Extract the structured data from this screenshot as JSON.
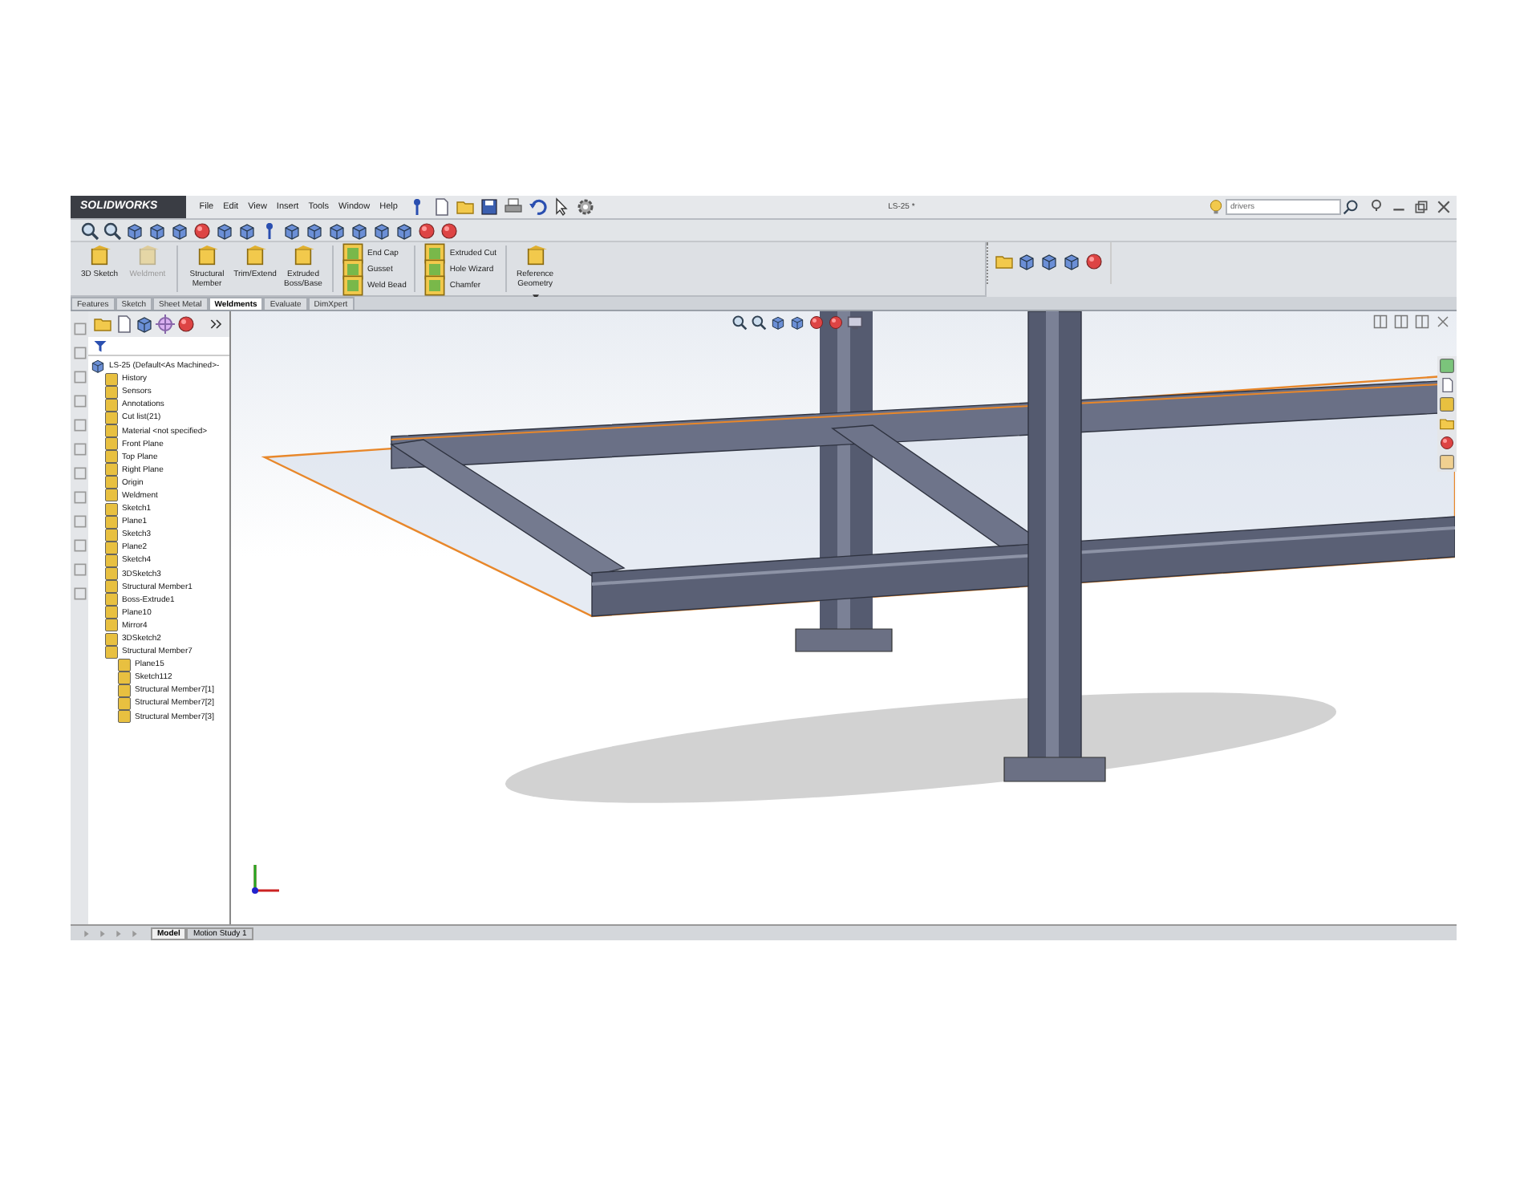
{
  "window": {
    "app": "SOLIDWORKS",
    "title": "LS-25 *"
  },
  "menu": [
    "File",
    "Edit",
    "View",
    "Insert",
    "Tools",
    "Window",
    "Help"
  ],
  "search": {
    "value": "drivers"
  },
  "command_groups": [
    {
      "kind": "large",
      "items": [
        {
          "label": "3D Sketch",
          "disabled": false
        },
        {
          "label": "Weldment",
          "disabled": true
        }
      ]
    },
    {
      "kind": "large",
      "items": [
        {
          "label": "Structural Member",
          "disabled": false
        },
        {
          "label": "Trim/Extend",
          "disabled": false
        },
        {
          "label": "Extruded Boss/Base",
          "disabled": false
        }
      ]
    },
    {
      "kind": "stack",
      "items": [
        {
          "label": "End Cap",
          "disabled": false
        },
        {
          "label": "Gusset",
          "disabled": false
        },
        {
          "label": "Weld Bead",
          "disabled": false
        }
      ]
    },
    {
      "kind": "stack",
      "items": [
        {
          "label": "Extruded Cut",
          "disabled": false
        },
        {
          "label": "Hole Wizard",
          "disabled": false
        },
        {
          "label": "Chamfer",
          "disabled": false
        }
      ]
    },
    {
      "kind": "large",
      "items": [
        {
          "label": "Reference Geometry",
          "disabled": false
        }
      ]
    }
  ],
  "tabs": [
    {
      "label": "Features",
      "selected": false
    },
    {
      "label": "Sketch",
      "selected": false
    },
    {
      "label": "Sheet Metal",
      "selected": false
    },
    {
      "label": "Weldments",
      "selected": true
    },
    {
      "label": "Evaluate",
      "selected": false
    },
    {
      "label": "DimXpert",
      "selected": false
    }
  ],
  "feature_tree": {
    "root": "LS-25  (Default<As Machined>-",
    "items": [
      {
        "label": "History"
      },
      {
        "label": "Sensors"
      },
      {
        "label": "Annotations"
      },
      {
        "label": "Cut list(21)"
      },
      {
        "label": "Material <not specified>"
      },
      {
        "label": "Front Plane"
      },
      {
        "label": "Top Plane"
      },
      {
        "label": "Right Plane"
      },
      {
        "label": "Origin"
      },
      {
        "label": "Weldment"
      },
      {
        "label": "Sketch1"
      },
      {
        "label": "Plane1"
      },
      {
        "label": "Sketch3"
      },
      {
        "label": "Plane2"
      },
      {
        "label": "Sketch4"
      },
      {
        "label": "3DSketch3"
      },
      {
        "label": "Structural Member1"
      },
      {
        "label": "Boss-Extrude1"
      },
      {
        "label": "Plane10"
      },
      {
        "label": "Mirror4"
      },
      {
        "label": "3DSketch2"
      },
      {
        "label": "Structural Member7",
        "children": [
          {
            "label": "Plane15"
          },
          {
            "label": "Sketch112"
          },
          {
            "label": "Structural Member7[1]"
          },
          {
            "label": "Structural Member7[2]"
          },
          {
            "label": "Structural Member7[3]"
          }
        ]
      }
    ]
  },
  "bottom_tabs": [
    {
      "label": "Model",
      "selected": true
    },
    {
      "label": "Motion Study 1",
      "selected": false
    }
  ]
}
